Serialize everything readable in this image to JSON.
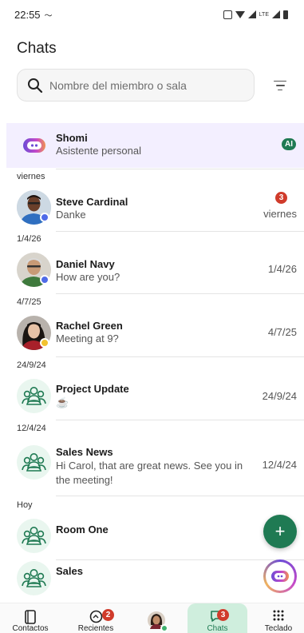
{
  "status": {
    "time": "22:55",
    "network": "LTE"
  },
  "page": {
    "title": "Chats"
  },
  "search": {
    "placeholder": "Nombre del miembro o sala"
  },
  "chats": [
    {
      "section": "",
      "name": "Shomi",
      "preview": "Asistente personal",
      "preview2": "",
      "time": "",
      "badge": "AI",
      "avatar": "ai-assistant-icon",
      "presence": ""
    },
    {
      "section": "viernes",
      "name": "Steve Cardinal",
      "preview": "Danke",
      "preview2": "",
      "time": "viernes",
      "badge": "3",
      "avatar": "contact-photo",
      "presence": "#4f6be8"
    },
    {
      "section": "1/4/26",
      "name": "Daniel Navy",
      "preview": "How are you?",
      "preview2": "",
      "time": "1/4/26",
      "badge": "",
      "avatar": "contact-photo",
      "presence": "#4f6be8"
    },
    {
      "section": "4/7/25",
      "name": "Rachel Green",
      "preview": "Meeting at 9?",
      "preview2": "",
      "time": "4/7/25",
      "badge": "",
      "avatar": "contact-photo",
      "presence": "#f2c230"
    },
    {
      "section": "24/9/24",
      "name": "Project Update",
      "preview": "☕",
      "preview2": "",
      "time": "24/9/24",
      "badge": "",
      "avatar": "group-icon",
      "presence": ""
    },
    {
      "section": "12/4/24",
      "name": "Sales News",
      "preview": "Hi Carol, that are great news. See you in",
      "preview2": "the meeting!",
      "time": "12/4/24",
      "badge": "",
      "avatar": "group-icon",
      "presence": ""
    },
    {
      "section": "Hoy",
      "name": "Room One",
      "preview": "",
      "preview2": "",
      "time": "",
      "badge": "",
      "avatar": "group-icon",
      "presence": ""
    },
    {
      "section": "",
      "name": "Sales",
      "preview": "",
      "preview2": "",
      "time": "",
      "badge": "",
      "avatar": "group-icon",
      "presence": ""
    }
  ],
  "fab": {
    "label": "+"
  },
  "nav": [
    {
      "label": "Contactos",
      "icon": "phone-book-icon",
      "badge": ""
    },
    {
      "label": "Recientes",
      "icon": "recent-calls-icon",
      "badge": "2"
    },
    {
      "label": "",
      "icon": "profile-avatar",
      "badge": ""
    },
    {
      "label": "Chats",
      "icon": "chat-bubble-icon",
      "badge": "3"
    },
    {
      "label": "Teclado",
      "icon": "dialpad-icon",
      "badge": ""
    }
  ],
  "colors": {
    "accent": "#1f7a53",
    "badge_red": "#d03b2b",
    "pinned_bg": "#f3efff",
    "active_nav": "#cfeedd"
  }
}
